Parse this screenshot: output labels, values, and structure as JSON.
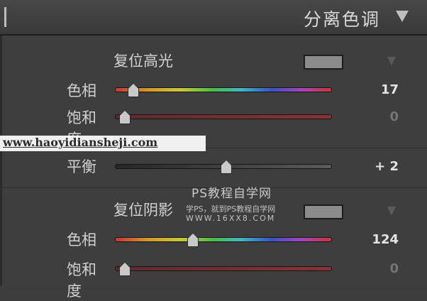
{
  "panel": {
    "title": "分离色调"
  },
  "highlights": {
    "title": "复位高光",
    "swatch_color": "#8b8b8b",
    "hue": {
      "label": "色相",
      "value": "17"
    },
    "saturation": {
      "label": "饱和度",
      "value": "0"
    }
  },
  "balance": {
    "label": "平衡",
    "value": "+ 2"
  },
  "shadows": {
    "title": "复位阴影",
    "swatch_color": "#8b8b8b",
    "hue": {
      "label": "色相",
      "value": "124"
    },
    "saturation": {
      "label": "饱和度",
      "value": "0"
    }
  },
  "watermarks": {
    "url": "www.haoyidiansheji.com",
    "brand": "PS教程自学网",
    "tagline": "学PS，就到PS教程自学网",
    "site": "WWW.16XX8.COM"
  },
  "icons": {
    "panel_toggle": "triangle-down-icon",
    "section_menu": "triangle-down-icon"
  }
}
